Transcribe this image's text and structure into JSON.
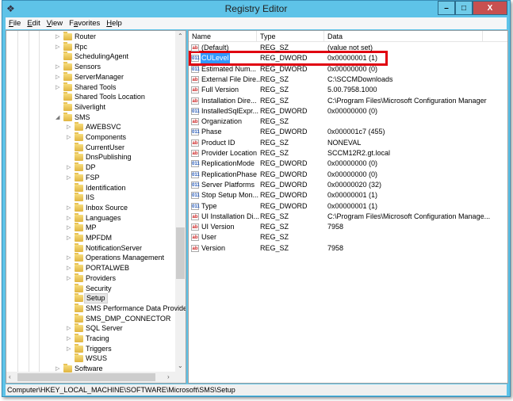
{
  "window": {
    "title": "Registry Editor",
    "min": "–",
    "max": "□",
    "close": "X"
  },
  "menu": [
    {
      "u": "F",
      "rest": "ile"
    },
    {
      "u": "E",
      "rest": "dit"
    },
    {
      "u": "V",
      "rest": "iew"
    },
    {
      "pre": "F",
      "u": "a",
      "rest": "vorites"
    },
    {
      "u": "H",
      "rest": "elp"
    }
  ],
  "tree": [
    {
      "label": "Router",
      "level": 1,
      "exp": true
    },
    {
      "label": "Rpc",
      "level": 1,
      "exp": true
    },
    {
      "label": "SchedulingAgent",
      "level": 1,
      "exp": false
    },
    {
      "label": "Sensors",
      "level": 1,
      "exp": true
    },
    {
      "label": "ServerManager",
      "level": 1,
      "exp": true
    },
    {
      "label": "Shared Tools",
      "level": 1,
      "exp": true
    },
    {
      "label": "Shared Tools Location",
      "level": 1,
      "exp": false
    },
    {
      "label": "Silverlight",
      "level": 1,
      "exp": false
    },
    {
      "label": "SMS",
      "level": 1,
      "exp": "open"
    },
    {
      "label": "AWEBSVC",
      "level": 2,
      "exp": true
    },
    {
      "label": "Components",
      "level": 2,
      "exp": true
    },
    {
      "label": "CurrentUser",
      "level": 2,
      "exp": false
    },
    {
      "label": "DnsPublishing",
      "level": 2,
      "exp": false
    },
    {
      "label": "DP",
      "level": 2,
      "exp": true
    },
    {
      "label": "FSP",
      "level": 2,
      "exp": true
    },
    {
      "label": "Identification",
      "level": 2,
      "exp": false
    },
    {
      "label": "IIS",
      "level": 2,
      "exp": false
    },
    {
      "label": "Inbox Source",
      "level": 2,
      "exp": true
    },
    {
      "label": "Languages",
      "level": 2,
      "exp": true
    },
    {
      "label": "MP",
      "level": 2,
      "exp": true
    },
    {
      "label": "MPFDM",
      "level": 2,
      "exp": true
    },
    {
      "label": "NotificationServer",
      "level": 2,
      "exp": false
    },
    {
      "label": "Operations Management",
      "level": 2,
      "exp": true
    },
    {
      "label": "PORTALWEB",
      "level": 2,
      "exp": true
    },
    {
      "label": "Providers",
      "level": 2,
      "exp": true
    },
    {
      "label": "Security",
      "level": 2,
      "exp": false
    },
    {
      "label": "Setup",
      "level": 2,
      "exp": false,
      "selected": true
    },
    {
      "label": "SMS Performance Data Provider",
      "level": 2,
      "exp": false
    },
    {
      "label": "SMS_DMP_CONNECTOR",
      "level": 2,
      "exp": false
    },
    {
      "label": "SQL Server",
      "level": 2,
      "exp": true
    },
    {
      "label": "Tracing",
      "level": 2,
      "exp": true
    },
    {
      "label": "Triggers",
      "level": 2,
      "exp": true
    },
    {
      "label": "WSUS",
      "level": 2,
      "exp": false
    },
    {
      "label": "Software",
      "level": 1,
      "exp": true
    }
  ],
  "columns": {
    "name": "Name",
    "type": "Type",
    "data": "Data"
  },
  "values": [
    {
      "name": "(Default)",
      "type": "REG_SZ",
      "data": "(value not set)",
      "icon": "sz"
    },
    {
      "name": "CULevel",
      "type": "REG_DWORD",
      "data": "0x00000001 (1)",
      "icon": "dw",
      "selected": true
    },
    {
      "name": "Estimated Num...",
      "type": "REG_DWORD",
      "data": "0x00000000 (0)",
      "icon": "dw"
    },
    {
      "name": "External File Dire...",
      "type": "REG_SZ",
      "data": "C:\\SCCMDownloads",
      "icon": "sz"
    },
    {
      "name": "Full Version",
      "type": "REG_SZ",
      "data": "5.00.7958.1000",
      "icon": "sz"
    },
    {
      "name": "Installation Dire...",
      "type": "REG_SZ",
      "data": "C:\\Program Files\\Microsoft Configuration Manager",
      "icon": "sz"
    },
    {
      "name": "InstalledSqlExpr...",
      "type": "REG_DWORD",
      "data": "0x00000000 (0)",
      "icon": "dw"
    },
    {
      "name": "Organization",
      "type": "REG_SZ",
      "data": "",
      "icon": "sz"
    },
    {
      "name": "Phase",
      "type": "REG_DWORD",
      "data": "0x000001c7 (455)",
      "icon": "dw"
    },
    {
      "name": "Product ID",
      "type": "REG_SZ",
      "data": "NONEVAL",
      "icon": "sz"
    },
    {
      "name": "Provider Location",
      "type": "REG_SZ",
      "data": "SCCM12R2.gt.local",
      "icon": "sz"
    },
    {
      "name": "ReplicationMode",
      "type": "REG_DWORD",
      "data": "0x00000000 (0)",
      "icon": "dw"
    },
    {
      "name": "ReplicationPhase",
      "type": "REG_DWORD",
      "data": "0x00000000 (0)",
      "icon": "dw"
    },
    {
      "name": "Server Platforms",
      "type": "REG_DWORD",
      "data": "0x00000020 (32)",
      "icon": "dw"
    },
    {
      "name": "Stop Setup Mon...",
      "type": "REG_DWORD",
      "data": "0x00000001 (1)",
      "icon": "dw"
    },
    {
      "name": "Type",
      "type": "REG_DWORD",
      "data": "0x00000001 (1)",
      "icon": "dw"
    },
    {
      "name": "UI Installation Di...",
      "type": "REG_SZ",
      "data": "C:\\Program Files\\Microsoft Configuration Manage...",
      "icon": "sz"
    },
    {
      "name": "UI Version",
      "type": "REG_SZ",
      "data": "7958",
      "icon": "sz"
    },
    {
      "name": "User",
      "type": "REG_SZ",
      "data": "",
      "icon": "sz"
    },
    {
      "name": "Version",
      "type": "REG_SZ",
      "data": "7958",
      "icon": "sz"
    }
  ],
  "icons": {
    "sz": "ab",
    "dw": "011"
  },
  "status": "Computer\\HKEY_LOCAL_MACHINE\\SOFTWARE\\Microsoft\\SMS\\Setup"
}
